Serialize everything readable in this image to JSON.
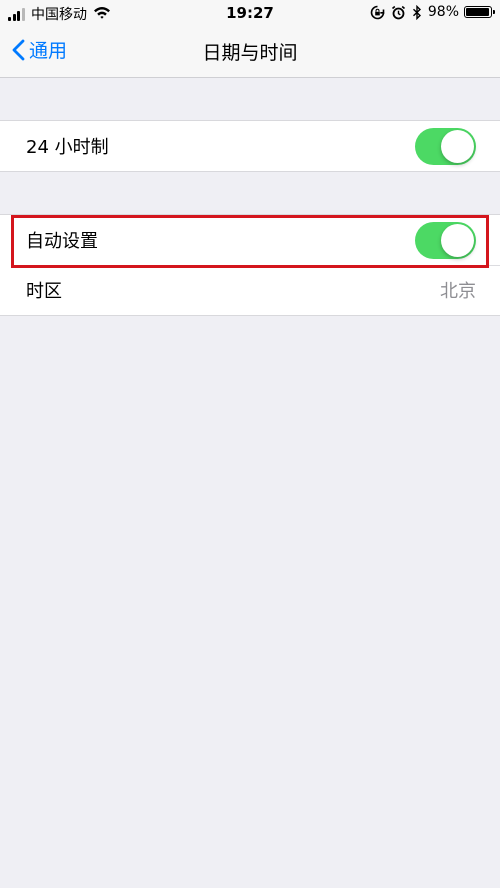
{
  "status_bar": {
    "carrier": "中国移动",
    "time": "19:27",
    "battery_percent": "98%",
    "battery_level": 0.98,
    "signal_bars_active": 3,
    "icons": [
      "signal-icon",
      "wifi-icon",
      "rotation-lock-icon",
      "alarm-icon",
      "bluetooth-icon",
      "battery-icon"
    ]
  },
  "nav": {
    "back_label": "通用",
    "title": "日期与时间"
  },
  "settings": {
    "hour24": {
      "label": "24 小时制",
      "on": true
    },
    "auto_set": {
      "label": "自动设置",
      "on": true
    },
    "timezone": {
      "label": "时区",
      "value": "北京"
    }
  },
  "colors": {
    "toggle_on": "#4cd964",
    "link_blue": "#007aff",
    "highlight_red": "#d4151d",
    "background": "#efeff4"
  }
}
